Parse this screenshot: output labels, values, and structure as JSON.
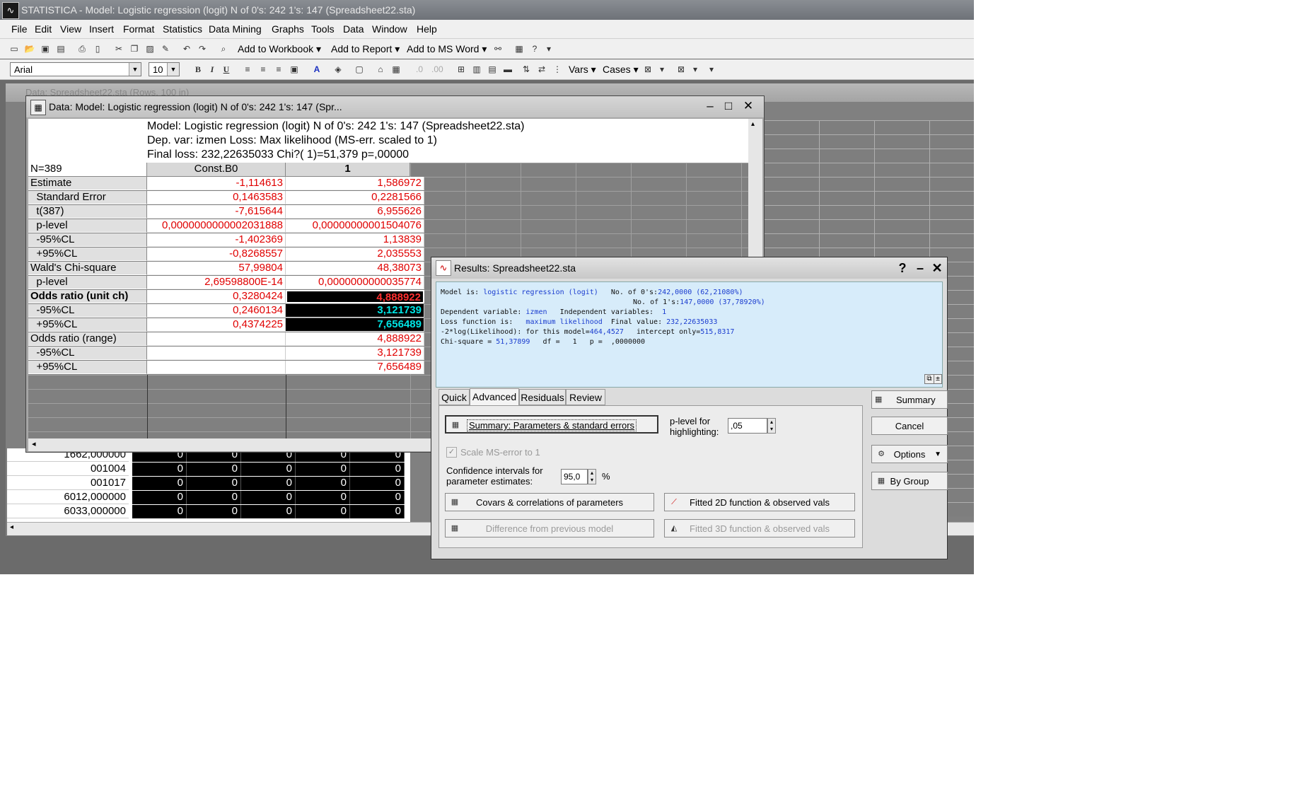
{
  "app": {
    "title": "STATISTICA - Model: Logistic regression (logit) N of 0's: 242 1's: 147 (Spreadsheet22.sta)"
  },
  "menu": [
    "File",
    "Edit",
    "View",
    "Insert",
    "Format",
    "Statistics",
    "Data Mining",
    "Graphs",
    "Tools",
    "Data",
    "Window",
    "Help"
  ],
  "toolbar1": {
    "add_workbook": "Add to Workbook",
    "add_report": "Add to Report",
    "add_msword": "Add to MS Word"
  },
  "toolbar2": {
    "font": "Arial",
    "size": "10",
    "bold": "B",
    "italic": "I",
    "underline": "U",
    "vars": "Vars",
    "cases": "Cases"
  },
  "bg_sheet": {
    "title": "Data: Spreadsheet22.sta (Rows, 100 in)",
    "rows": [
      {
        "label": "1662,000000",
        "vals": [
          "0",
          "0",
          "0",
          "0",
          "0"
        ]
      },
      {
        "label": "001004",
        "vals": [
          "0",
          "0",
          "0",
          "0",
          "0"
        ]
      },
      {
        "label": "001017",
        "vals": [
          "0",
          "0",
          "0",
          "0",
          "0"
        ]
      },
      {
        "label": "6012,000000",
        "vals": [
          "0",
          "0",
          "0",
          "0",
          "0"
        ]
      },
      {
        "label": "6033,000000",
        "vals": [
          "0",
          "0",
          "0",
          "0",
          "0"
        ]
      }
    ]
  },
  "data_window": {
    "title": "Data: Model: Logistic regression (logit) N of 0's: 242 1's: 147 (Spr...",
    "header_lines": [
      "Model: Logistic regression (logit) N of 0's: 242 1's: 147 (Spreadsheet22.sta)",
      "Dep. var: izmen Loss: Max likelihood (MS-err. scaled to 1)",
      "Final loss: 232,22635033 Chi?( 1)=51,379 p=,00000"
    ],
    "n_label": "N=389",
    "columns": [
      "Const.B0",
      "1"
    ],
    "rows": [
      {
        "label": "Estimate",
        "c1": "-1,114613",
        "c2": "1,586972"
      },
      {
        "label": "  Standard Error",
        "c1": "0,1463583",
        "c2": "0,2281566"
      },
      {
        "label": "  t(387)",
        "c1": "-7,615644",
        "c2": "6,955626"
      },
      {
        "label": "  p-level",
        "c1": "0,0000000000002031888",
        "c2": "0,00000000001504076"
      },
      {
        "label": "  -95%CL",
        "c1": "-1,402369",
        "c2": "1,13839"
      },
      {
        "label": "  +95%CL",
        "c1": "-0,8268557",
        "c2": "2,035553"
      },
      {
        "label": "Wald's Chi-square",
        "c1": "57,99804",
        "c2": "48,38073"
      },
      {
        "label": "  p-level",
        "c1": "2,69598800E-14",
        "c2": "0,0000000000035774"
      },
      {
        "label": "Odds ratio (unit ch)",
        "c1": "0,3280424",
        "c2": "4,888922"
      },
      {
        "label": "  -95%CL",
        "c1": "0,2460134",
        "c2": "3,121739"
      },
      {
        "label": "  +95%CL",
        "c1": "0,4374225",
        "c2": "7,656489"
      },
      {
        "label": "Odds ratio (range)",
        "c1": "",
        "c2": "4,888922"
      },
      {
        "label": "  -95%CL",
        "c1": "",
        "c2": "3,121739"
      },
      {
        "label": "  +95%CL",
        "c1": "",
        "c2": "7,656489"
      }
    ]
  },
  "results": {
    "title": "Results: Spreadsheet22.sta",
    "report": {
      "l1a": "Model is: ",
      "l1b": "logistic regression (logit)",
      "l1c": "   No. of 0's:",
      "l1d": "242,0000 (62,21080%)",
      "l2c": "No. of 1's:",
      "l2d": "147,0000 (37,78920%)",
      "l3a": "Dependent variable: ",
      "l3b": "izmen",
      "l3c": "   Independent variables:  ",
      "l3d": "1",
      "l4a": "Loss function is:   ",
      "l4b": "maximum likelihood",
      "l4c": "  Final value: ",
      "l4d": "232,22635033",
      "l5a": "-2*log(Likelihood): for this model=",
      "l5b": "464,4527",
      "l5c": "   intercept only=",
      "l5d": "515,8317",
      "l6a": "Chi-square = ",
      "l6b": "51,37899",
      "l6c": "   df =   1   p =  ,0000000"
    },
    "tabs": [
      "Quick",
      "Advanced",
      "Residuals",
      "Review"
    ],
    "buttons": {
      "summary_params": "Summary: Parameters & standard errors",
      "covars": "Covars & correlations of parameters",
      "diff_prev": "Difference from previous model",
      "fitted2d": "Fitted 2D function & observed vals",
      "fitted3d": "Fitted 3D function & observed vals"
    },
    "plevel_label": "p-level for highlighting:",
    "plevel_value": ",05",
    "scale_ms": "Scale MS-error to 1",
    "ci_label": "Confidence intervals for parameter estimates:",
    "ci_value": "95,0",
    "ci_unit": "%",
    "side": {
      "summary": "Summary",
      "cancel": "Cancel",
      "options": "Options",
      "bygroup": "By Group"
    }
  }
}
